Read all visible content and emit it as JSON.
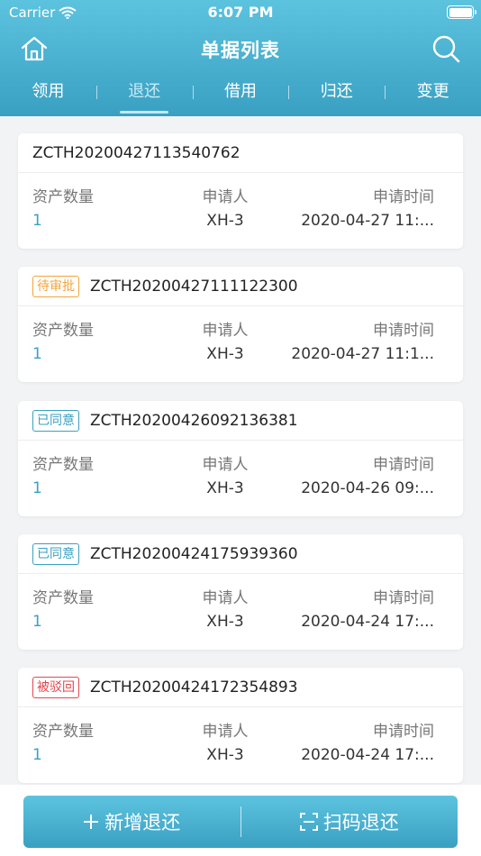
{
  "status_bar": {
    "carrier": "Carrier",
    "time": "6:07 PM"
  },
  "nav": {
    "title": "单据列表",
    "home_icon": "home-icon",
    "search_icon": "search-icon"
  },
  "tabs": [
    {
      "label": "领用"
    },
    {
      "label": "退还"
    },
    {
      "label": "借用"
    },
    {
      "label": "归还"
    },
    {
      "label": "变更"
    }
  ],
  "active_tab": "退还",
  "columns": {
    "count": "资产数量",
    "applicant": "申请人",
    "time": "申请时间"
  },
  "records": [
    {
      "badge": "",
      "no": "ZCTH20200427113540762",
      "count": "1",
      "applicant": "XH-3",
      "time": "2020-04-27 11:..."
    },
    {
      "badge": "待审批",
      "no": "ZCTH20200427111122300",
      "count": "1",
      "applicant": "XH-3",
      "time": "2020-04-27 11:1..."
    },
    {
      "badge": "已同意",
      "no": "ZCTH20200426092136381",
      "count": "1",
      "applicant": "XH-3",
      "time": "2020-04-26 09:..."
    },
    {
      "badge": "已同意",
      "no": "ZCTH20200424175939360",
      "count": "1",
      "applicant": "XH-3",
      "time": "2020-04-24 17:..."
    },
    {
      "badge": "被驳回",
      "no": "ZCTH20200424172354893",
      "count": "1",
      "applicant": "XH-3",
      "time": "2020-04-24 17:..."
    }
  ],
  "actions": {
    "add": "新增退还",
    "scan": "扫码退还"
  },
  "colors": {
    "primary": "#3aa0c2",
    "pending": "#f3a43a",
    "rejected": "#e0484f"
  }
}
